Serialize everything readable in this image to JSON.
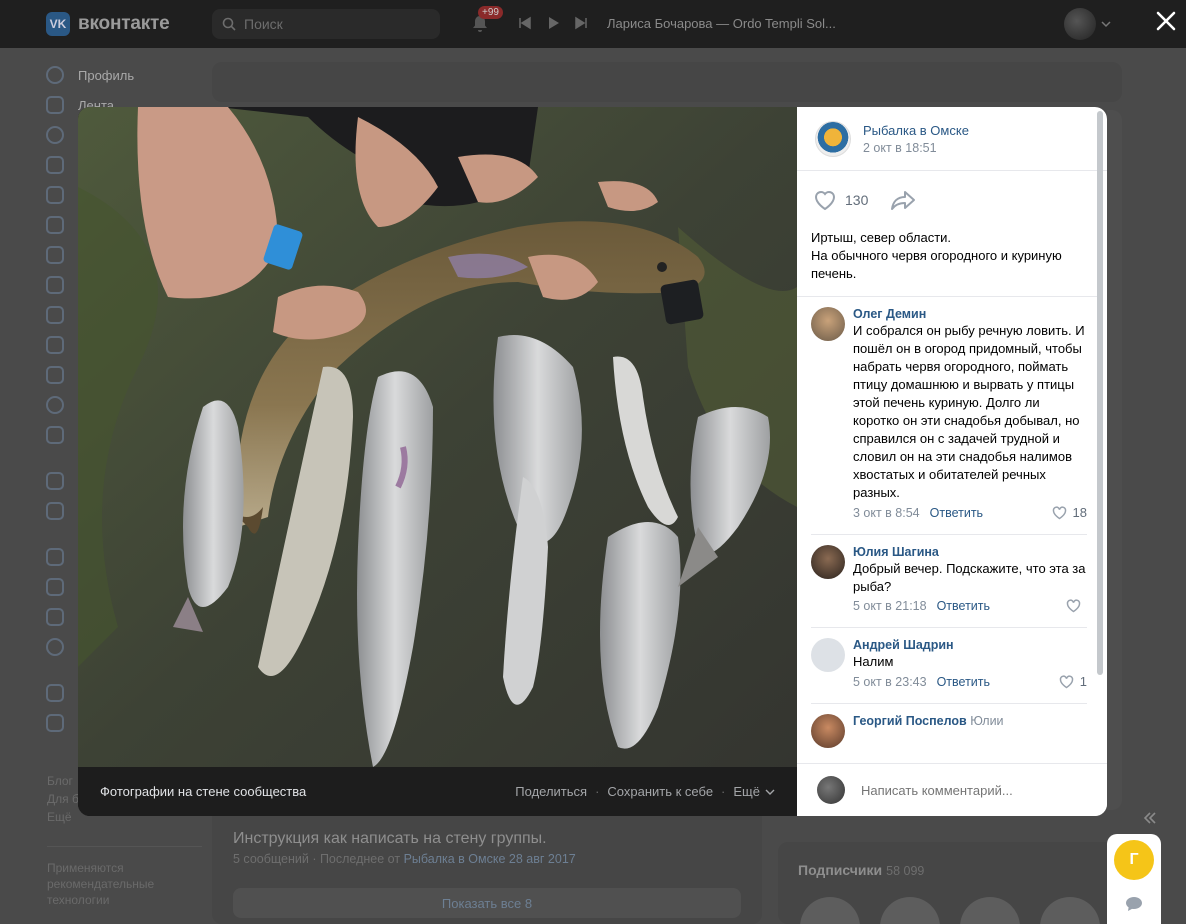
{
  "topbar": {
    "logo_text": "вконтакте",
    "search_placeholder": "Поиск",
    "notifications_badge": "+99",
    "now_playing": "Лариса Бочарова — Ordo Templi Sol..."
  },
  "sidebar": {
    "items": [
      {
        "label": "Профиль"
      },
      {
        "label": "Лента"
      }
    ],
    "links": [
      "Блог",
      "Для б",
      "Ещё"
    ],
    "footer": "Применяются рекомендательные технологии"
  },
  "background": {
    "topic_title": "Инструкция как написать на стену группы.",
    "topic_meta_prefix": "5 сообщений · Последнее от",
    "topic_meta_author": "Рыбалка в Омске",
    "topic_meta_date": "28 авг 2017",
    "show_all": "Показать все 8",
    "subscribers_label": "Подписчики",
    "subscribers_count": "58 099"
  },
  "viewer": {
    "album": "Фотографии на стене сообщества",
    "actions": [
      "Поделиться",
      "Сохранить к себе",
      "Ещё"
    ],
    "group_name": "Рыбалка в Омске",
    "post_date": "2 окт в 18:51",
    "likes": "130",
    "description_line1": "Иртыш, север области.",
    "description_line2": "На обычного червя огородного и куриную печень.",
    "comments": [
      {
        "author": "Олег Демин",
        "text": "И собрался он рыбу речную ловить. И пошёл он в огород придомный, чтобы набрать червя огородного, поймать птицу домашнюю и вырвать у птицы этой печень куриную. Долго ли коротко он эти снадобья добывал, но справился он с задачей трудной и словил он на эти снадобья налимов хвостатых и обитателей речных разных.",
        "date": "3 окт в 8:54",
        "reply": "Ответить",
        "likes": "18"
      },
      {
        "author": "Юлия Шагина",
        "text": "Добрый вечер. Подскажите, что эта за рыба?",
        "date": "5 окт в 21:18",
        "reply": "Ответить",
        "likes": ""
      },
      {
        "author": "Андрей Шадрин",
        "text": "Налим",
        "date": "5 окт в 23:43",
        "reply": "Ответить",
        "likes": "1"
      },
      {
        "author": "Георгий Поспелов",
        "reply_to": "Юлии",
        "text": "",
        "date": "",
        "reply": "",
        "likes": ""
      }
    ],
    "compose_placeholder": "Написать комментарий..."
  },
  "chat": {
    "avatar_letter": "Г"
  },
  "colors": {
    "link": "#2a5885",
    "accent_yellow": "#f5c518",
    "overlay": "#4a4a4a"
  }
}
